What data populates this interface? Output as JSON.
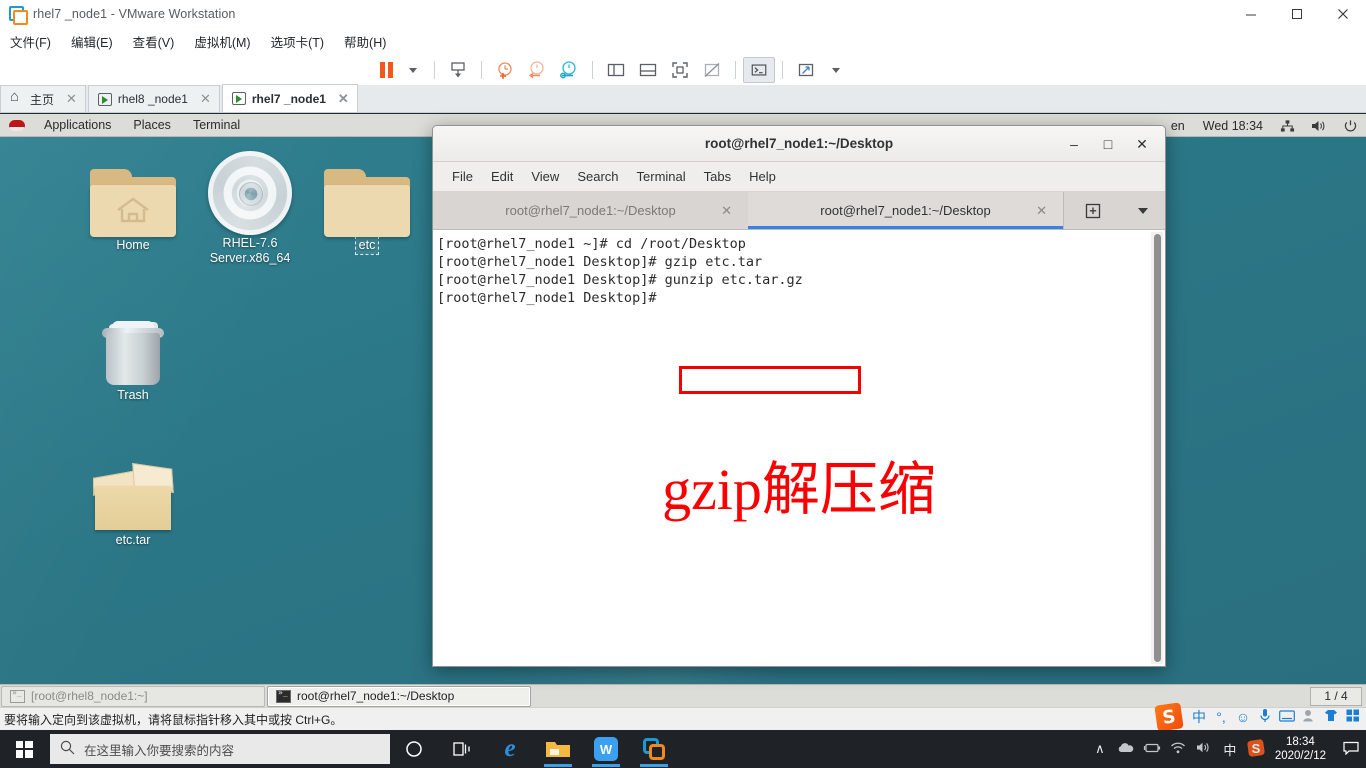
{
  "vmware": {
    "title": "rhel7 _node1 - VMware Workstation",
    "logo_icon": "vmware-logo-icon",
    "window_buttons": [
      {
        "name": "minimize-button",
        "glyph": "—"
      },
      {
        "name": "maximize-button",
        "glyph": "❐"
      },
      {
        "name": "close-button",
        "glyph": "✕"
      }
    ],
    "menu": [
      {
        "label": "文件(F)",
        "key": "F"
      },
      {
        "label": "编辑(E)",
        "key": "E"
      },
      {
        "label": "查看(V)",
        "key": "V"
      },
      {
        "label": "虚拟机(M)",
        "key": "M"
      },
      {
        "label": "选项卡(T)",
        "key": "T"
      },
      {
        "label": "帮助(H)",
        "key": "H"
      }
    ],
    "toolbar": [
      {
        "name": "suspend-button",
        "icon": "pause-icon"
      },
      {
        "name": "power-dropdown",
        "icon": "caret-down-icon"
      },
      {
        "name": "snapshot-button",
        "icon": "snapshot-save-icon"
      },
      {
        "name": "take-snapshot-button",
        "icon": "clock-plus-icon"
      },
      {
        "name": "revert-snapshot-button",
        "icon": "clock-back-icon"
      },
      {
        "name": "snapshot-manager-button",
        "icon": "clock-wrench-icon"
      },
      {
        "name": "show-sidebar-button",
        "icon": "panel-left-icon"
      },
      {
        "name": "show-thumbnail-button",
        "icon": "panel-bottom-icon"
      },
      {
        "name": "fullscreen-button",
        "icon": "fullscreen-icon"
      },
      {
        "name": "unity-button",
        "icon": "unity-icon"
      },
      {
        "name": "console-button",
        "icon": "terminal-prompt-icon"
      },
      {
        "name": "stretch-button",
        "icon": "expand-arrows-icon"
      },
      {
        "name": "stretch-dropdown",
        "icon": "caret-down-icon"
      }
    ],
    "tabs": [
      {
        "label": "主页",
        "icon": "home-icon",
        "active": false
      },
      {
        "label": "rhel8 _node1",
        "icon": "vm-icon",
        "active": false
      },
      {
        "label": "rhel7 _node1",
        "icon": "vm-icon",
        "active": true
      }
    ],
    "status_text": "要将输入定向到该虚拟机，请将鼠标指针移入其中或按 Ctrl+G。"
  },
  "gnome": {
    "topbar": {
      "logo_icon": "redhat-logo-icon",
      "menus": [
        "Applications",
        "Places",
        "Terminal"
      ],
      "keyboard_layout": "en",
      "clock": "Wed 18:34",
      "tray_icons": [
        "network-icon",
        "volume-icon",
        "power-icon"
      ]
    },
    "desktop_icons": [
      {
        "label": "Home",
        "icon": "folder-home-icon",
        "selected": false
      },
      {
        "label": "RHEL-7.6 Server.x86_64",
        "icon": "optical-disc-icon",
        "selected": false
      },
      {
        "label": "etc",
        "icon": "folder-icon",
        "selected": true
      },
      {
        "label": "Trash",
        "icon": "trash-icon",
        "selected": false
      },
      {
        "label": "etc.tar",
        "icon": "archive-box-icon",
        "selected": false
      }
    ],
    "bottom_panel": {
      "windows": [
        {
          "label": "[root@rhel8_node1:~]",
          "icon": "terminal-icon",
          "active": false
        },
        {
          "label": "root@rhel7_node1:~/Desktop",
          "icon": "terminal-icon",
          "active": true
        }
      ],
      "workspace": "1 / 4"
    }
  },
  "terminal": {
    "title": "root@rhel7_node1:~/Desktop",
    "window_buttons": [
      {
        "name": "minimize-button",
        "glyph": "–"
      },
      {
        "name": "maximize-button",
        "glyph": "□"
      },
      {
        "name": "close-button",
        "glyph": "✕"
      }
    ],
    "menu": [
      "File",
      "Edit",
      "View",
      "Search",
      "Terminal",
      "Tabs",
      "Help"
    ],
    "tabs": [
      {
        "label": "root@rhel7_node1:~/Desktop",
        "active": false
      },
      {
        "label": "root@rhel7_node1:~/Desktop",
        "active": true
      }
    ],
    "new_tab_icon": "new-tab-icon",
    "tab_menu_icon": "caret-down-icon",
    "lines": [
      "[root@rhel7_node1 ~]# cd /root/Desktop",
      "[root@rhel7_node1 Desktop]# gzip etc.tar",
      "[root@rhel7_node1 Desktop]# gunzip etc.tar.gz",
      "[root@rhel7_node1 Desktop]# "
    ],
    "annotation": {
      "text": "gzip解压缩",
      "color": "#fa0000",
      "highlight_box_color": "#f40000",
      "highlighted_command": "gunzip etc.tar.gz"
    }
  },
  "windows_taskbar": {
    "start_icon": "windows-logo-icon",
    "search_placeholder": "在这里输入你要搜索的内容",
    "search_icon": "search-icon",
    "pinned": [
      {
        "name": "cortana-icon",
        "running": false
      },
      {
        "name": "task-view-icon",
        "running": false
      },
      {
        "name": "edge-icon",
        "running": false
      },
      {
        "name": "file-explorer-icon",
        "running": true
      },
      {
        "name": "wps-icon",
        "running": true
      },
      {
        "name": "vmware-icon",
        "running": true
      }
    ],
    "tray": [
      {
        "name": "show-hidden-icons",
        "glyph": "∧"
      },
      {
        "name": "onedrive-icon",
        "glyph": "☁"
      },
      {
        "name": "battery-icon",
        "glyph": "⎓"
      },
      {
        "name": "wifi-icon",
        "glyph": "◠"
      },
      {
        "name": "volume-icon",
        "glyph": "🔊"
      },
      {
        "name": "ime-indicator",
        "glyph": "中"
      }
    ],
    "sogou_icon": "sogou-ime-icon",
    "clock_time": "18:34",
    "clock_date": "2020/2/12",
    "notification_icon": "notification-icon"
  },
  "ime_bar": {
    "logo": "sogou-logo-icon",
    "items": [
      {
        "name": "chinese-mode-icon",
        "glyph": "中"
      },
      {
        "name": "punctuation-icon",
        "glyph": "°,"
      },
      {
        "name": "emoji-icon",
        "glyph": "☺"
      },
      {
        "name": "voice-input-icon",
        "glyph": "🎤"
      },
      {
        "name": "soft-keyboard-icon",
        "glyph": "⌨"
      },
      {
        "name": "user-icon",
        "glyph": "👤"
      },
      {
        "name": "skin-icon",
        "glyph": "👕"
      },
      {
        "name": "toolbox-icon",
        "glyph": "▦"
      }
    ]
  }
}
